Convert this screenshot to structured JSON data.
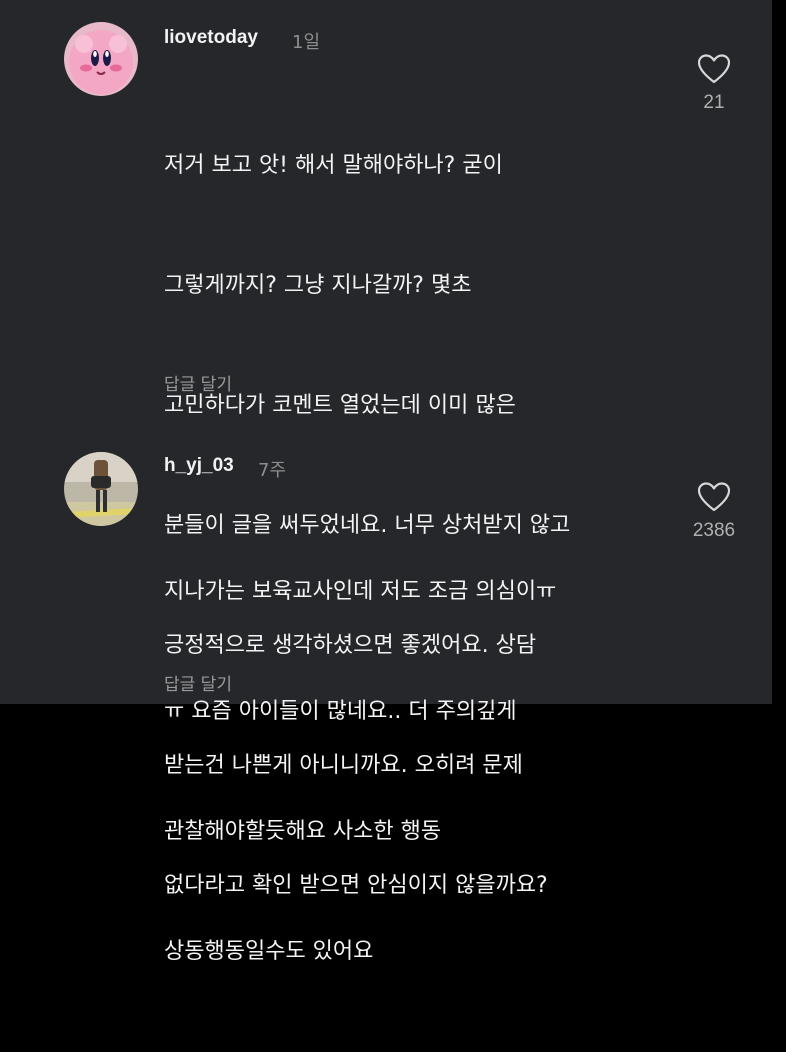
{
  "comments": [
    {
      "username": "liovetoday",
      "time": "1일",
      "lines": [
        "저거 보고 앗! 해서 말해야하나? 굳이",
        "그렇게까지? 그냥 지나갈까? 몇초",
        "고민하다가 코멘트 열었는데 이미 많은",
        "분들이 글을 써두었네요. 너무 상처받지 않고",
        "긍정적으로 생각하셨으면 좋겠어요. 상담",
        "받는건 나쁜게 아니니까요. 오히려 문제",
        "없다라고 확인 받으면 안심이지 않을까요?"
      ],
      "reply_label": "답글 달기",
      "like_count": "21"
    },
    {
      "username": "h_yj_03",
      "time": "7주",
      "lines": [
        "지나가는 보육교사인데 저도 조금 의심이ㅠ",
        "ㅠ 요즘 아이들이 많네요.. 더 주의깊게",
        "관찰해야할듯해요 사소한 행동",
        "상동행동일수도 있어요"
      ],
      "reply_label": "답글 달기",
      "like_count": "2386"
    }
  ],
  "colors": {
    "background": "#25272b",
    "text": "#f4f4f4",
    "muted": "#8e8e8e",
    "avatar1": "#f0a8c8",
    "avatar2": "#c9c4b8"
  },
  "icons": {
    "like": "heart-outline-icon"
  }
}
